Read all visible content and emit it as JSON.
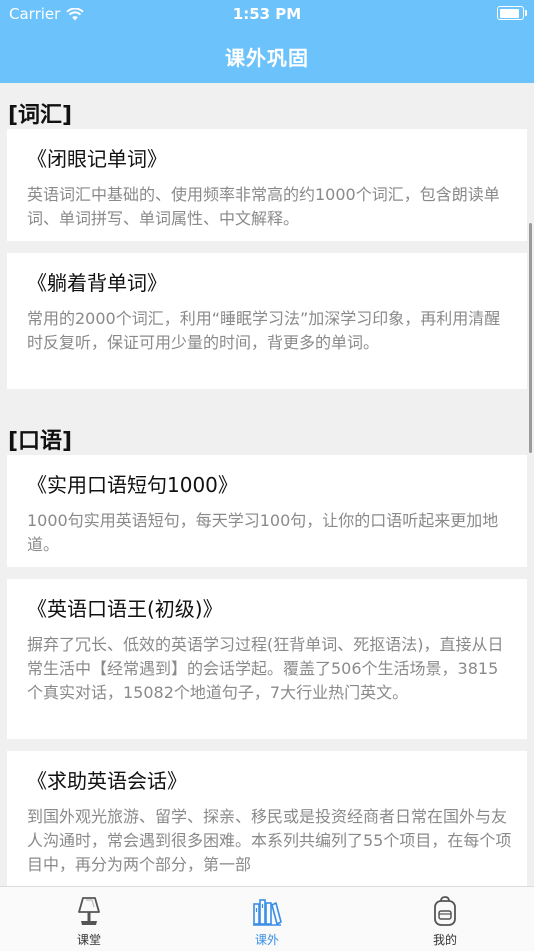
{
  "status_bar": {
    "carrier": "Carrier",
    "time": "1:53 PM",
    "battery_level": 0.95
  },
  "nav": {
    "title": "课外巩固"
  },
  "sections": [
    {
      "title": "[词汇]",
      "items": [
        {
          "title": "《闭眼记单词》",
          "desc": "英语词汇中基础的、使用频率非常高的约1000个词汇，包含朗读单词、单词拼写、单词属性、中文解释。"
        },
        {
          "title": "《躺着背单词》",
          "desc": "常用的2000个词汇，利用“睡眠学习法”加深学习印象，再利用清醒时反复听，保证可用少量的时间，背更多的单词。"
        }
      ]
    },
    {
      "title": "[口语]",
      "items": [
        {
          "title": "《实用口语短句1000》",
          "desc": "1000句实用英语短句，每天学习100句，让你的口语听起来更加地道。"
        },
        {
          "title": "《英语口语王(初级)》",
          "desc": "摒弃了冗长、低效的英语学习过程(狂背单词、死抠语法)，直接从日常生活中【经常遇到】的会话学起。覆盖了506个生活场景，3815个真实对话，15082个地道句子，7大行业热门英文。"
        },
        {
          "title": "《求助英语会话》",
          "desc": "到国外观光旅游、留学、探亲、移民或是投资经商者日常在国外与友人沟通时，常会遇到很多困难。本系列共编列了55个项目，在每个项目中，再分为两个部分，第一部"
        }
      ]
    }
  ],
  "tabs": [
    {
      "label": "课堂",
      "icon": "lamp-icon"
    },
    {
      "label": "课外",
      "icon": "books-icon",
      "active": true
    },
    {
      "label": "我的",
      "icon": "backpack-icon"
    }
  ],
  "colors": {
    "header": "#6cc2fb",
    "active_tab": "#3a8ee6",
    "desc_text": "#8a8a8a"
  }
}
